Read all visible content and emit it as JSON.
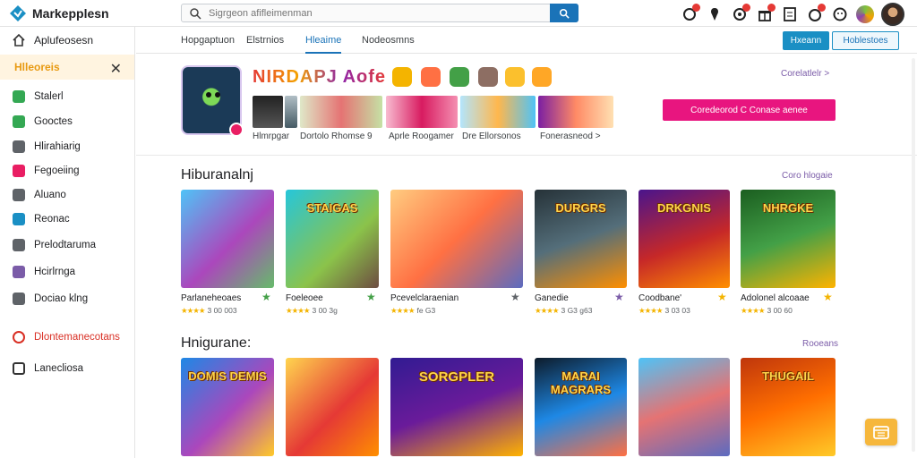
{
  "app": {
    "name": "Markepplesn"
  },
  "search": {
    "placeholder": "Sigrgeon afifleimenman"
  },
  "sidebar": {
    "home_label": "Aplufeosesn",
    "category_label": "Hlleoreis",
    "items": [
      {
        "label": "Stalerl",
        "color": "#34a853"
      },
      {
        "label": "Gooctes",
        "color": "#34a853"
      },
      {
        "label": "Hlirahiarig",
        "color": "#5f6368"
      },
      {
        "label": "Fegoeiing",
        "color": "#e91e63"
      },
      {
        "label": "Aluano",
        "color": "#5f6368"
      },
      {
        "label": "Reonac",
        "color": "#1a8fc4"
      },
      {
        "label": "Prelodtaruma",
        "color": "#5f6368"
      },
      {
        "label": "Hcirlrnga",
        "color": "#7b5ca8"
      },
      {
        "label": "Dociao klng",
        "color": "#5f6368"
      }
    ],
    "red_item": "Dlontemanecotans",
    "last_item": "Lanecliosa"
  },
  "subnav": {
    "tabs": [
      {
        "label": "Hopgaptuon",
        "active": false
      },
      {
        "label": "Elstrnios",
        "active": false
      },
      {
        "label": "Hleaime",
        "active": true
      },
      {
        "label": "Nodeosmns",
        "active": false
      }
    ],
    "primary_button": "Hxeann",
    "outline_button": "Hoblestoes"
  },
  "featured": {
    "title": "NIRDAPJ Aofe",
    "screenshots": [
      "Hlmrpgar",
      "Dortolo Rhomse 9",
      "Aprle Roogamer",
      "Dre Ellorsonos",
      "Fonerasneod >"
    ],
    "link": "Corelatlelr >",
    "cta": "Coredeorod C Conase aenee"
  },
  "section1": {
    "title": "Hiburanalnj",
    "link": "Coro hlogaie",
    "cards": [
      {
        "title": "Parlaneheoaes",
        "rating": "4.5",
        "meta": "3 00 003",
        "art": ""
      },
      {
        "title": "Foeleoee",
        "rating": "4.5",
        "meta": "3 00 3g",
        "art": "STAIGAS"
      },
      {
        "title": "Pcevelclaraenian",
        "rating": "4.5",
        "meta": "fe G3",
        "art": ""
      },
      {
        "title": "Ganedie",
        "rating": "4.5",
        "meta": "3 G3 g63",
        "art": "DURGRS"
      },
      {
        "title": "Coodbane'",
        "rating": "4.5",
        "meta": "3 03 03",
        "art": "DRKGNIS"
      },
      {
        "title": "Adolonel alcoaae",
        "rating": "4.5",
        "meta": "3 00 60",
        "art": "NHRGKE"
      }
    ]
  },
  "section2": {
    "title": "Hnigurane:",
    "link": "Rooeans",
    "cards": [
      {
        "art": "DOMIS DEMIS"
      },
      {
        "art": ""
      },
      {
        "art": "SORGPLER"
      },
      {
        "art": "MARAI MAGRARS"
      },
      {
        "art": ""
      },
      {
        "art": "THUGAIL"
      }
    ]
  },
  "colors": {
    "accent": "#1a73b8",
    "cta": "#e8157f",
    "category_bg": "#fff4e0",
    "category_text": "#e89a12"
  }
}
